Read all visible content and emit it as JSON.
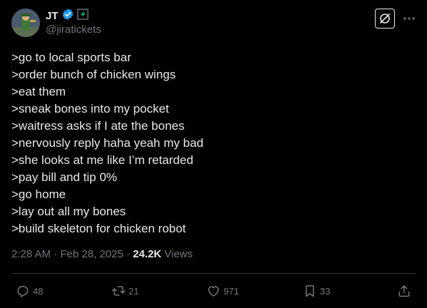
{
  "author": {
    "display_name": "JT",
    "handle": "@jiratickets"
  },
  "icons": {
    "verified": "verified-badge-icon",
    "affiliate": "affiliate-badge-icon",
    "grok": "grok-icon",
    "more": "more-horizontal-icon",
    "reply": "reply-icon",
    "repost": "repost-icon",
    "like": "like-icon",
    "bookmark": "bookmark-icon",
    "share": "share-icon"
  },
  "colors": {
    "background": "#000000",
    "text": "#e7e9ea",
    "muted": "#71767b",
    "verified": "#1d9bf0",
    "divider": "#2f3336"
  },
  "tweet": {
    "lines": [
      ">go to local sports bar",
      ">order bunch of chicken wings",
      ">eat them",
      ">sneak bones into my pocket",
      ">waitress asks if I ate the bones",
      ">nervously reply haha yeah my bad",
      ">she looks at me like I’m retarded",
      ">pay bill and tip 0%",
      ">go home",
      ">lay out all my bones",
      ">build skeleton for chicken robot"
    ],
    "timestamp": "2:28 AM · Feb 28, 2025 · ",
    "views_count": "24.2K",
    "views_label": "Views"
  },
  "actions": {
    "replies": "48",
    "reposts": "21",
    "likes": "971",
    "bookmarks": "33"
  }
}
